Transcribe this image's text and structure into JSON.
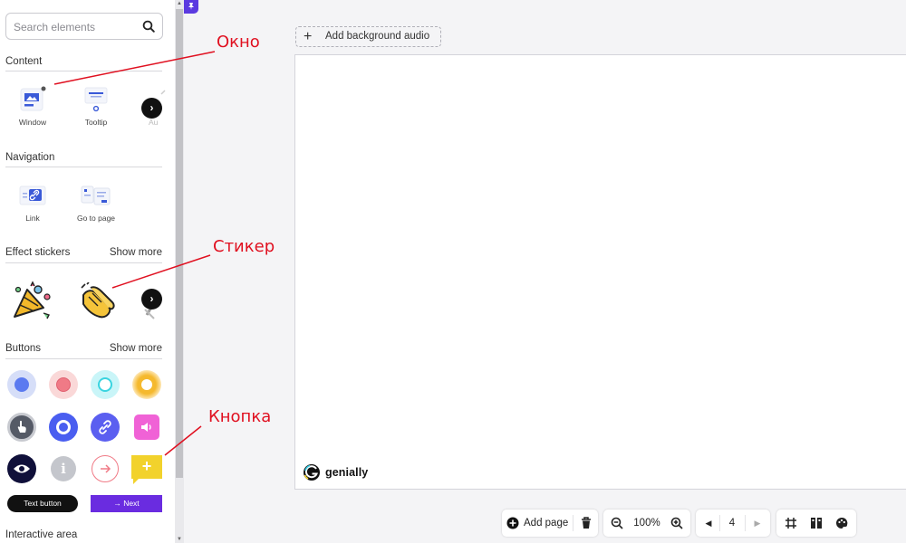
{
  "sidebar": {
    "search": {
      "placeholder": "Search elements"
    },
    "content": {
      "title": "Content",
      "tiles": [
        {
          "label": "Window",
          "icon": "window-icon"
        },
        {
          "label": "Tooltip",
          "icon": "tooltip-icon"
        },
        {
          "label": "Au",
          "icon": "audio-icon"
        }
      ]
    },
    "navigation": {
      "title": "Navigation",
      "tiles": [
        {
          "label": "Link",
          "icon": "link-icon"
        },
        {
          "label": "Go to page",
          "icon": "go-to-page-icon"
        }
      ]
    },
    "effect_stickers": {
      "title": "Effect stickers",
      "show_more": "Show more",
      "stickers": [
        "confetti-sticker",
        "clapping-hands-sticker",
        "partial-sticker"
      ]
    },
    "buttons": {
      "title": "Buttons",
      "show_more": "Show more",
      "text_button": "Text button",
      "next_button": "Next",
      "next_arrow": "→",
      "info_glyph": "i",
      "plus_glyph": "+"
    },
    "interactive_area": {
      "title": "Interactive area"
    }
  },
  "canvas": {
    "add_audio_label": "Add background audio",
    "add_audio_plus": "+",
    "brand_name": "genially"
  },
  "toolbar": {
    "add_page": "Add page",
    "zoom": "100%",
    "page_number": "4"
  },
  "annotations": {
    "window": "Окно",
    "sticker": "Стикер",
    "button": "Кнопка"
  },
  "colors": {
    "accent_purple": "#6a2ce0",
    "annotation_red": "#e01020",
    "button_blue": "#5b6cf0",
    "button_pink": "#f07a86",
    "button_teal": "#39d4e0",
    "button_yellow": "#f5b92e",
    "button_magenta": "#f062d6",
    "button_navy": "#10103a",
    "button_gold": "#f2d22c"
  }
}
